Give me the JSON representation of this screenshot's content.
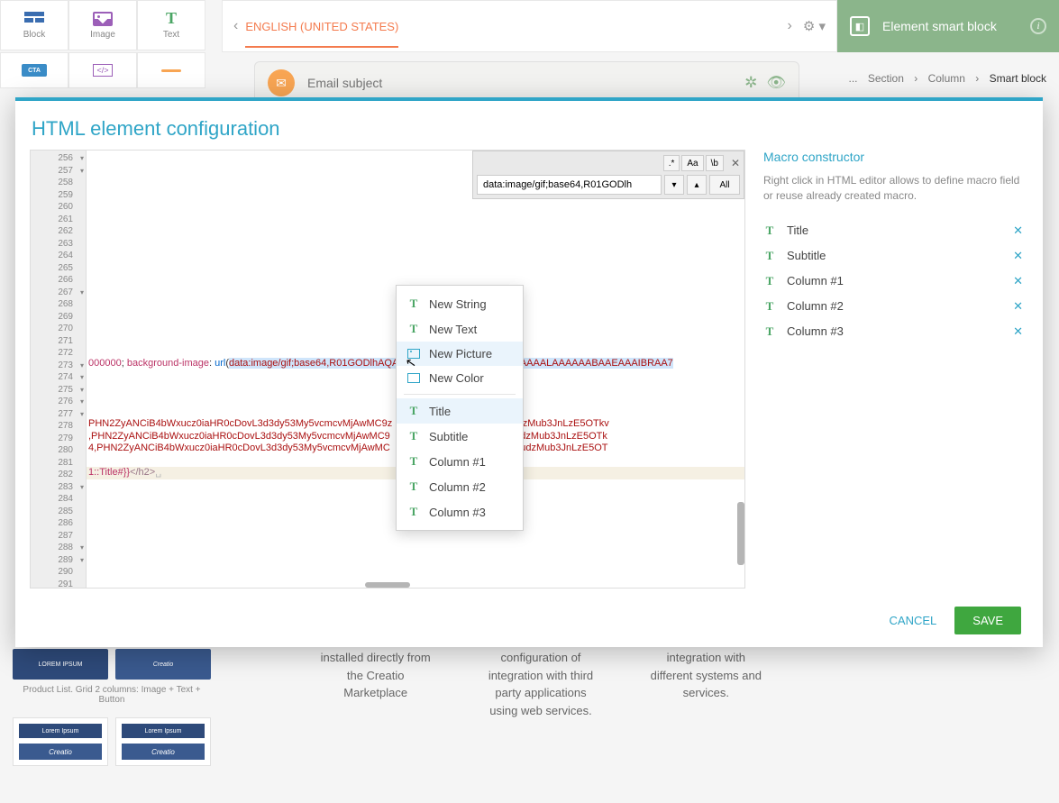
{
  "toolbar": {
    "block": "Block",
    "image": "Image",
    "text": "Text",
    "cta": "CTA"
  },
  "header": {
    "language": "ENGLISH (UNITED STATES)"
  },
  "right_panel": {
    "title": "Element smart block"
  },
  "breadcrumb": {
    "items": [
      "Section",
      "Column",
      "Smart block"
    ],
    "sep": "›",
    "prefix": "..."
  },
  "email": {
    "placeholder": "Email subject"
  },
  "modal": {
    "title": "HTML element configuration",
    "cancel": "CANCEL",
    "save": "SAVE"
  },
  "search": {
    "regex": ".*",
    "case": "Aa",
    "word": "\\b",
    "value": "data:image/gif;base64,R01GODlh",
    "all": "All"
  },
  "editor": {
    "line_start": 256,
    "fold_lines": [
      256,
      257,
      267,
      273,
      274,
      275,
      276,
      277,
      283,
      288,
      289
    ],
    "line273": "000000; background-image: url(data:image/gif;base64,R01GODlhAQABAIAAAAAAAP///yH5BAEAAAAALAAAAAABAAEAAAIBRAA7",
    "line278": "PHN2ZyANCiB4bWxucz0iaHR0cDovL3d3dy53My5vcmcvMjAwMC9z         s9Imh0dHA6Ly93d3cudzMub3JnLzE5OTkv",
    "line279": ",PHN2ZyANCiB4bWxucz0iaHR0cDovL3d3dy53My5vcmcvMjAwMC9        ms9Imh0dHA6Ly93d3cudzMub3JnLzE5OTk",
    "line280": "4,PHN2ZyANCiB4bWxucz0iaHR0cDovL3d3dy53My5vcmcvMjAwMC        bms9Imh0dHA6Ly93d3cudzMub3JnLzE5OT",
    "line282": "1::Title#}}</h2>␣"
  },
  "context_menu": {
    "new_string": "New String",
    "new_text": "New Text",
    "new_picture": "New Picture",
    "new_color": "New Color",
    "title": "Title",
    "subtitle": "Subtitle",
    "col1": "Column #1",
    "col2": "Column #2",
    "col3": "Column #3"
  },
  "macro": {
    "title": "Macro constructor",
    "hint": "Right click in HTML editor allows to define macro field or reuse already created macro.",
    "items": [
      "Title",
      "Subtitle",
      "Column #1",
      "Column #2",
      "Column #3"
    ]
  },
  "bg_text": {
    "c1": "installed directly from the Creatio Marketplace",
    "c2": "configuration of integration with third party applications using web services.",
    "c3": "integration with different systems and services."
  },
  "sidebar_bottom": {
    "label": "Product List. Grid 2 columns: Image + Text + Button",
    "lorem": "Lorem Ipsum",
    "btn": "LOREM IPSUM"
  }
}
